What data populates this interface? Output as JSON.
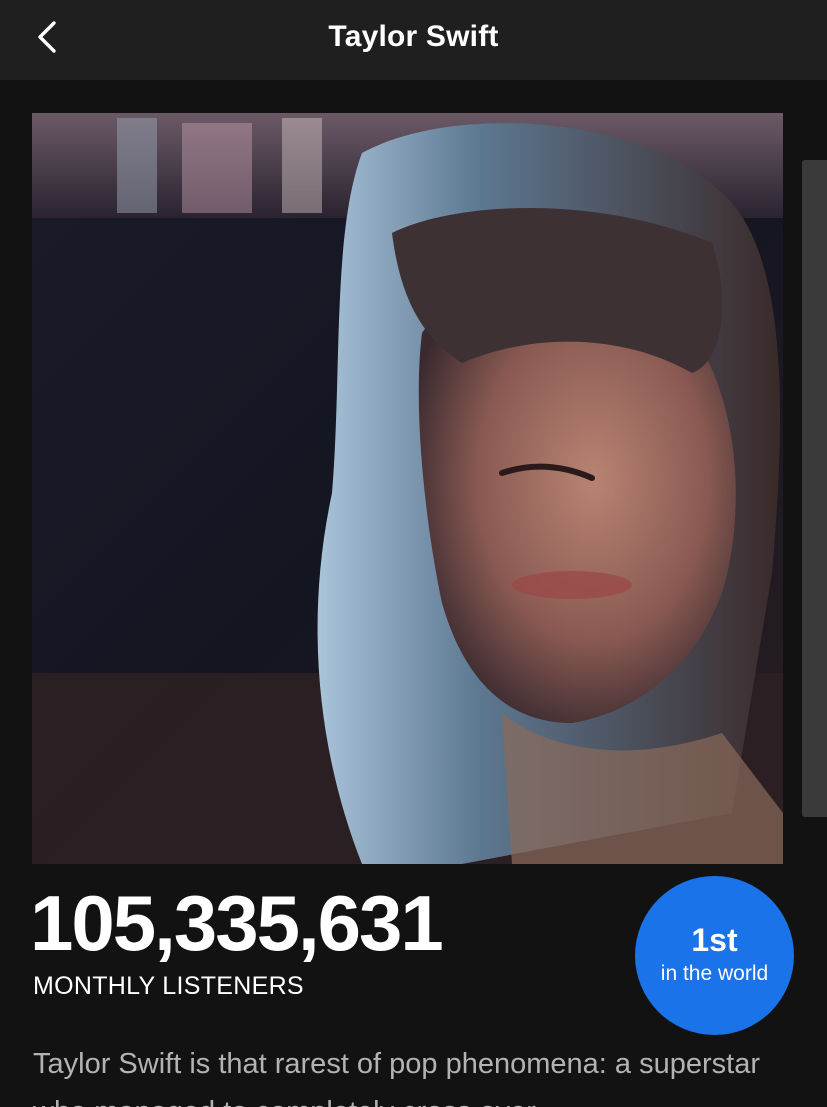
{
  "header": {
    "title": "Taylor Swift",
    "back_icon": "chevron-left-icon"
  },
  "stats": {
    "monthly_listeners": "105,335,631",
    "monthly_listeners_label": "MONTHLY LISTENERS",
    "rank_value": "1st",
    "rank_label": "in the world",
    "rank_color": "#1a73e8"
  },
  "about": {
    "bio": "Taylor Swift is that rarest of pop phenomena: a superstar who managed to completely cross over"
  },
  "colors": {
    "background": "#121212",
    "header_background": "#1f1f1f",
    "text_secondary": "#b3b3b3"
  }
}
